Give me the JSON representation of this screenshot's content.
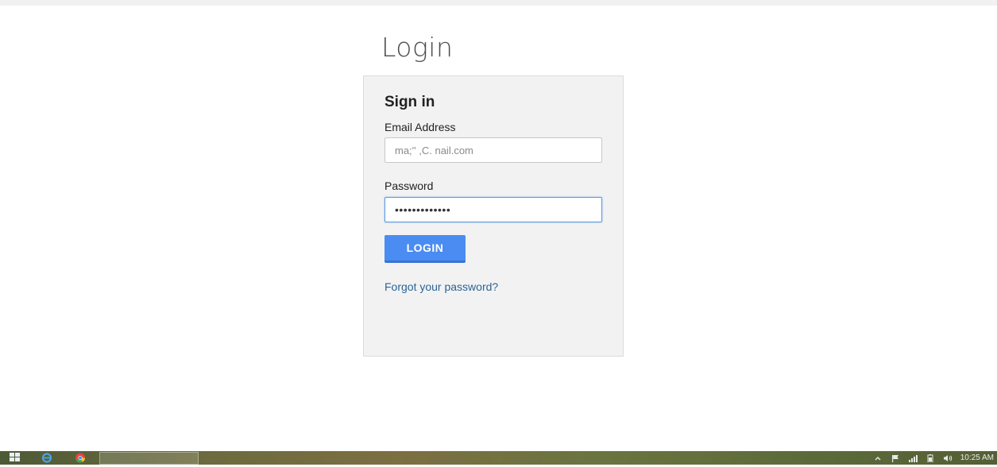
{
  "page": {
    "heading": "Login"
  },
  "signin": {
    "title": "Sign in",
    "email_label": "Email Address",
    "email_value": "ma;'' ,C. nail.com",
    "password_label": "Password",
    "password_value": "•••••••••••••",
    "login_button": "LOGIN",
    "forgot_link": "Forgot your password?"
  },
  "taskbar": {
    "clock": "10:25 AM",
    "icons": [
      "windows-start-icon",
      "internet-explorer-icon",
      "chrome-icon"
    ],
    "tray_icons": [
      "show-hidden-icon",
      "flag-icon",
      "network-icon",
      "battery-icon",
      "volume-icon"
    ]
  },
  "colors": {
    "primary_button": "#4a8cf1",
    "link": "#2a6496",
    "panel_bg": "#f2f2f2"
  }
}
